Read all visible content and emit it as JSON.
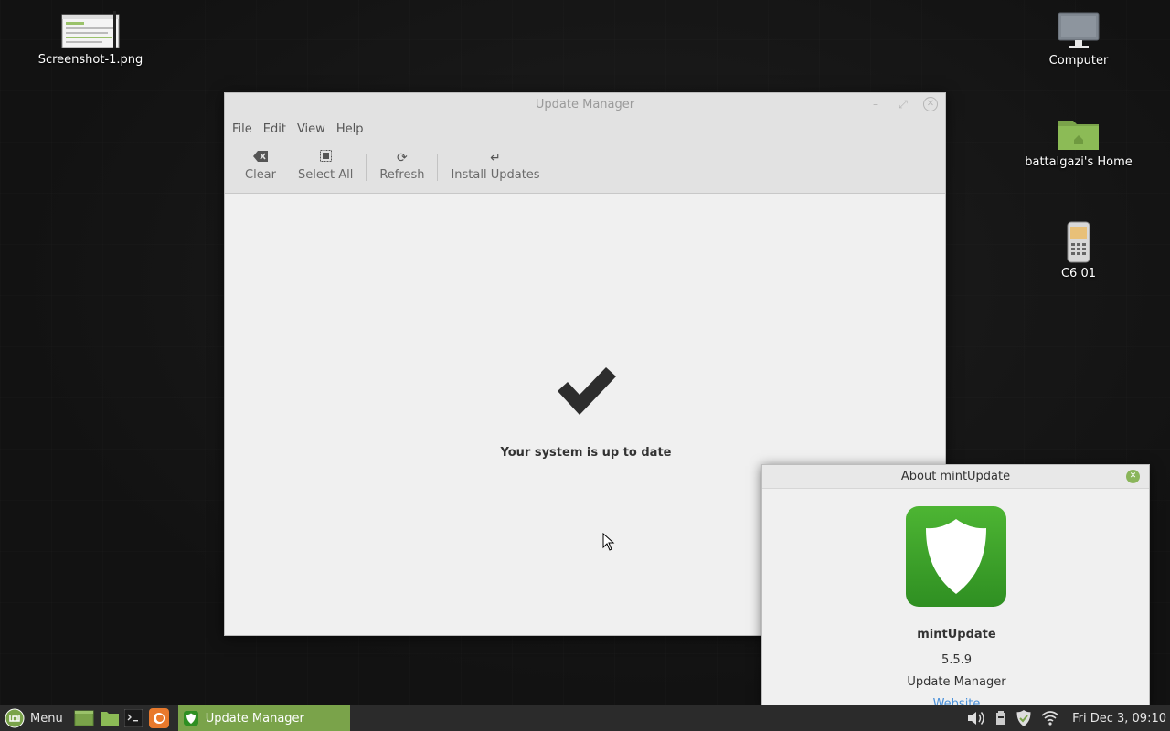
{
  "desktop": {
    "icons": [
      {
        "label": "Screenshot-1.png",
        "icon": "image-file-icon"
      },
      {
        "label": "Computer",
        "icon": "computer-icon"
      },
      {
        "label": "battalgazi's Home",
        "icon": "home-folder-icon"
      },
      {
        "label": "C6 01",
        "icon": "phone-icon"
      }
    ]
  },
  "window": {
    "title": "Update Manager",
    "menu": [
      "File",
      "Edit",
      "View",
      "Help"
    ],
    "toolbar": {
      "clear": "Clear",
      "select_all": "Select All",
      "refresh": "Refresh",
      "install": "Install Updates"
    },
    "status": "Your system is up to date"
  },
  "about": {
    "title": "About mintUpdate",
    "name": "mintUpdate",
    "version": "5.5.9",
    "description": "Update Manager",
    "link": "Website"
  },
  "taskbar": {
    "menu_label": "Menu",
    "task_label": "Update Manager",
    "clock": "Fri Dec  3, 09:10"
  },
  "colors": {
    "accent": "#7aa34a",
    "shield_green": "#3fa32b",
    "link": "#4a90d9"
  }
}
